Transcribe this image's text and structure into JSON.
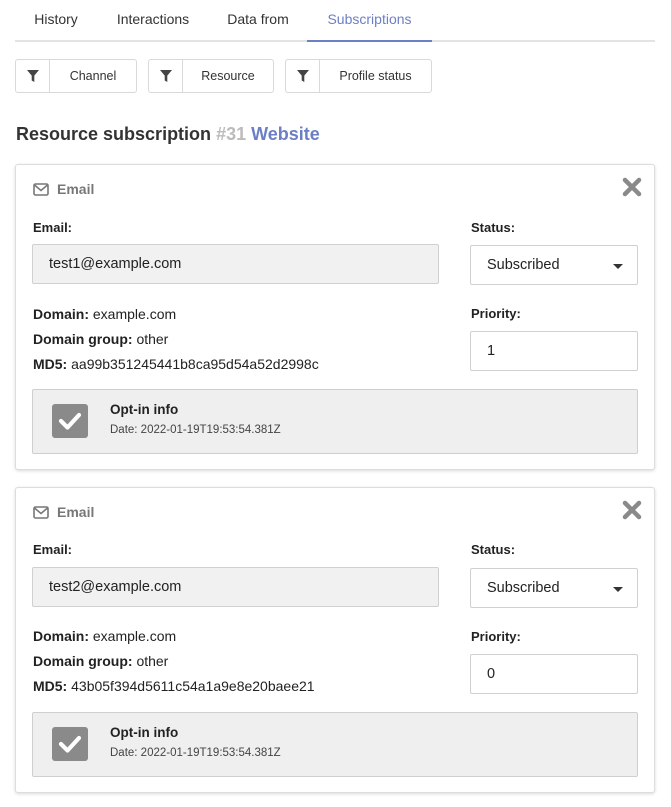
{
  "tabs": [
    {
      "label": "History"
    },
    {
      "label": "Interactions"
    },
    {
      "label": "Data from"
    },
    {
      "label": "Subscriptions",
      "active": true
    }
  ],
  "filters": [
    {
      "label": "Channel",
      "icon": "filter-icon"
    },
    {
      "label": "Resource",
      "icon": "filter-icon"
    },
    {
      "label": "Profile status",
      "icon": "filter-icon"
    }
  ],
  "heading": {
    "title": "Resource subscription",
    "id": "#31",
    "resource": "Website"
  },
  "colors": {
    "accent": "#6c7fc4",
    "muted_id": "#bbbbbb",
    "check_bg": "#8a8a8a"
  },
  "cards": [
    {
      "title": "Email",
      "email_label": "Email:",
      "email": "test1@example.com",
      "status_label": "Status:",
      "status": "Subscribed",
      "priority_label": "Priority:",
      "priority": "1",
      "domain_label": "Domain:",
      "domain": "example.com",
      "domain_group_label": "Domain group:",
      "domain_group": "other",
      "md5_label": "MD5:",
      "md5": "aa99b351245441b8ca95d54a52d2998c",
      "optin_title": "Opt-in info",
      "optin_date": "Date: 2022-01-19T19:53:54.381Z"
    },
    {
      "title": "Email",
      "email_label": "Email:",
      "email": "test2@example.com",
      "status_label": "Status:",
      "status": "Subscribed",
      "priority_label": "Priority:",
      "priority": "0",
      "domain_label": "Domain:",
      "domain": "example.com",
      "domain_group_label": "Domain group:",
      "domain_group": "other",
      "md5_label": "MD5:",
      "md5": "43b05f394d5611c54a1a9e8e20baee21",
      "optin_title": "Opt-in info",
      "optin_date": "Date: 2022-01-19T19:53:54.381Z"
    }
  ]
}
